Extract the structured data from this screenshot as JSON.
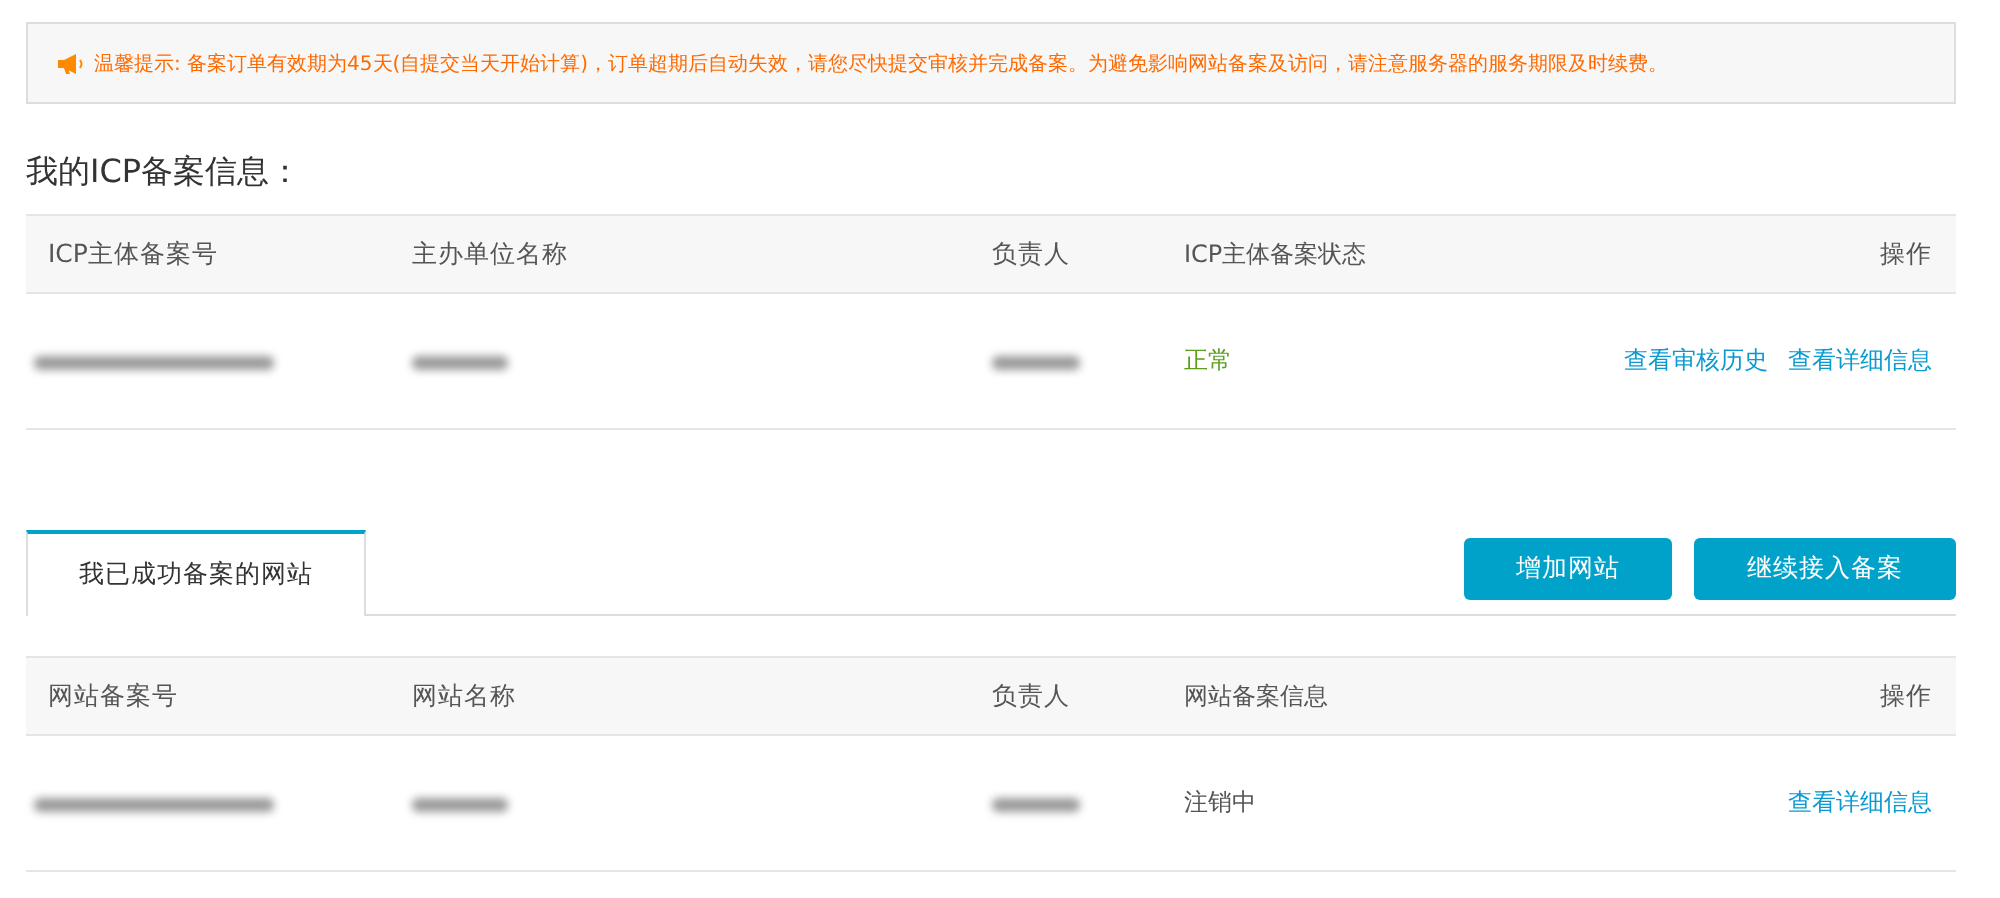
{
  "notice": {
    "text": "温馨提示: 备案订单有效期为45天(自提交当天开始计算)，订单超期后自动失效，请您尽快提交审核并完成备案。为避免影响网站备案及访问，请注意服务器的服务期限及时续费。"
  },
  "icp_section": {
    "title": "我的ICP备案信息：",
    "columns": [
      "ICP主体备案号",
      "主办单位名称",
      "负责人",
      "ICP主体备案状态",
      "操作"
    ],
    "rows": [
      {
        "cells": [
          {
            "kind": "redacted"
          },
          {
            "kind": "redacted"
          },
          {
            "kind": "redacted"
          }
        ],
        "status": {
          "text": "正常",
          "kind": "normal"
        },
        "actions": [
          "查看审核历史",
          "查看详细信息"
        ]
      }
    ]
  },
  "sites_section": {
    "tabs": [
      {
        "label": "我已成功备案的网站",
        "selected": true
      }
    ],
    "buttons": [
      "增加网站",
      "继续接入备案"
    ],
    "columns": [
      "网站备案号",
      "网站名称",
      "负责人",
      "网站备案信息",
      "操作"
    ],
    "rows": [
      {
        "cells": [
          {
            "kind": "redacted"
          },
          {
            "kind": "redacted"
          },
          {
            "kind": "redacted"
          }
        ],
        "status": {
          "text": "注销中",
          "kind": "cancelling"
        },
        "actions": [
          "查看详细信息"
        ]
      }
    ]
  }
}
